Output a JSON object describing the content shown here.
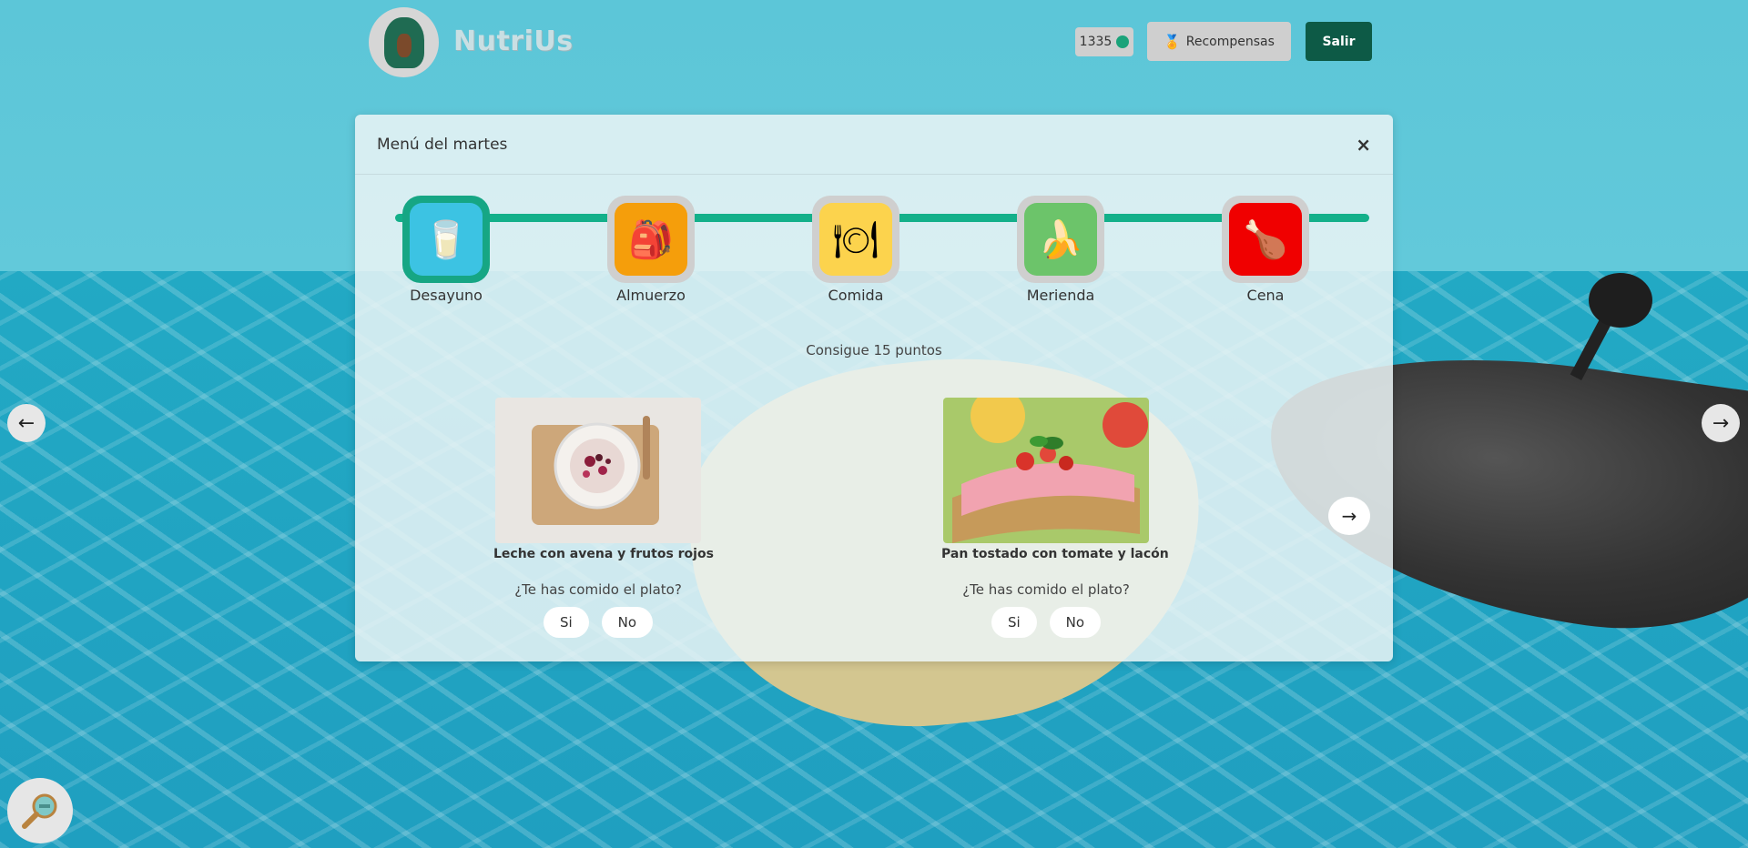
{
  "header": {
    "brand": "NutriUs",
    "points": "1335",
    "rewards_label": "Recompensas",
    "exit_label": "Salir"
  },
  "modal": {
    "title": "Menú del martes",
    "close_label": "×",
    "meals": [
      {
        "label": "Desayuno",
        "icon": "breakfast-icon",
        "color": "#3cc3e3",
        "glyph": "🥛",
        "active": true
      },
      {
        "label": "Almuerzo",
        "icon": "lunchbox-icon",
        "color": "#f59e0b",
        "glyph": "🎒",
        "active": false
      },
      {
        "label": "Comida",
        "icon": "plate-icon",
        "color": "#fcd34d",
        "glyph": "🍽",
        "active": false
      },
      {
        "label": "Merienda",
        "icon": "banana-icon",
        "color": "#6cc46a",
        "glyph": "🍌",
        "active": false
      },
      {
        "label": "Cena",
        "icon": "dinner-icon",
        "color": "#f00000",
        "glyph": "🍗",
        "active": false
      }
    ],
    "goal": "Consigue 15 puntos",
    "dishes": [
      {
        "name": "Leche con avena y frutos rojos",
        "question": "¿Te has comido el plato?",
        "yes": "Si",
        "no": "No"
      },
      {
        "name": "Pan tostado con tomate y lacón",
        "question": "¿Te has comido el plato?",
        "yes": "Si",
        "no": "No"
      }
    ]
  },
  "colors": {
    "accent": "#13b08a",
    "exit_button": "#0d5a46"
  }
}
